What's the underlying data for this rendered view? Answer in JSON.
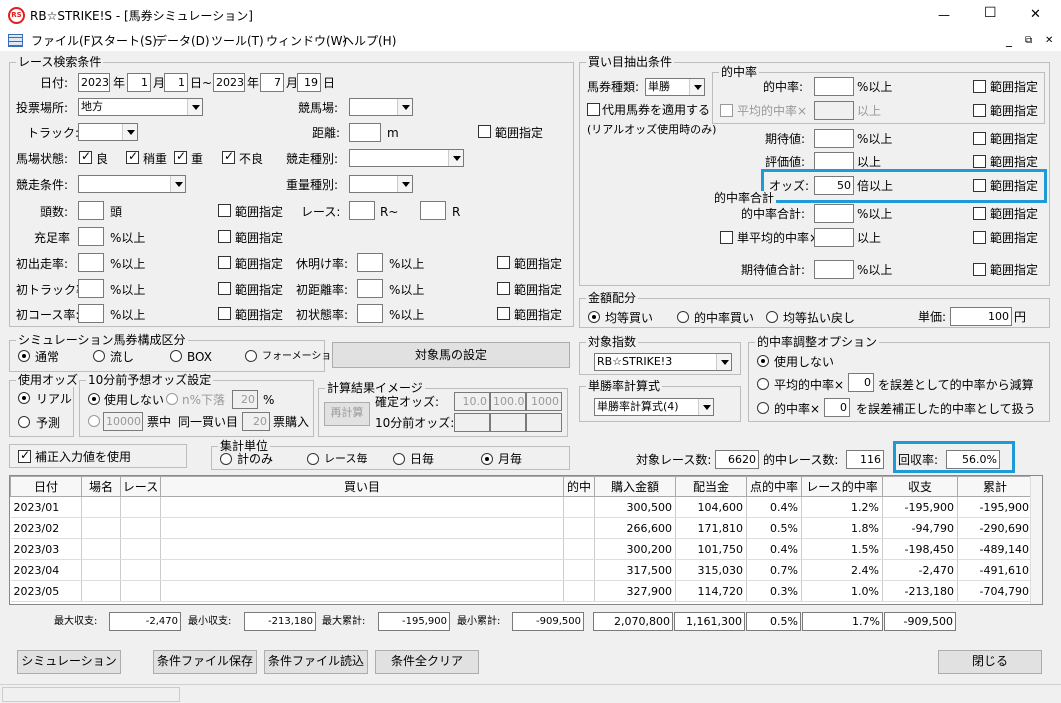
{
  "window": {
    "title": "RB☆STRIKE!S - [馬券シミュレーション]",
    "min": "—",
    "max": "☐",
    "close": "✕",
    "logo": "RS"
  },
  "menu": [
    "ファイル(F)",
    "スタート(S)",
    "データ(D)",
    "ツール(T)",
    "ウィンドウ(W)",
    "ヘルプ(H)"
  ],
  "race": {
    "group": "レース検索条件",
    "date_label": "日付:",
    "from_y": "2023",
    "nen1": "年",
    "from_m": "1",
    "tsuki1": "月",
    "from_d": "1",
    "nichi_tilde": "日~",
    "to_y": "2023",
    "nen2": "年",
    "to_m": "7",
    "tsuki2": "月",
    "to_d": "19",
    "nichi2": "日",
    "venue_label": "投票場所:",
    "venue": "地方",
    "course_label": "競馬場:",
    "track_label": "トラック:",
    "dist_label": "距離:",
    "dist_unit": "m",
    "range": "範囲指定",
    "cond_label": "馬場状態:",
    "cond_ryo": "良",
    "cond_yayaomo": "稍重",
    "cond_omo": "重",
    "cond_furyo": "不良",
    "type_label": "競走種別:",
    "jouken_label": "競走条件:",
    "weight_label": "重量種別:",
    "heads_label": "頭数:",
    "heads_unit": "頭",
    "race_label": "レース:",
    "race_mid": "R~",
    "race_end": "R",
    "jusoku_label": "充足率",
    "pct_ijo": "%以上",
    "first_run": "初出走率:",
    "rest": "休明け率:",
    "first_track": "初トラック率:",
    "first_dist": "初距離率:",
    "first_course": "初コース率:",
    "first_cond": "初状態率:"
  },
  "sim": {
    "group": "シミュレーション馬券構成区分",
    "opts": [
      "通常",
      "流し",
      "BOX",
      "フォーメーション"
    ],
    "target_btn": "対象馬の設定"
  },
  "odds_use": {
    "group": "使用オッズ",
    "opts": [
      "リアル",
      "予測"
    ]
  },
  "odds10": {
    "group": "10分前予想オッズ設定",
    "nouse": "使用しない",
    "n_drop": "n%下落",
    "n_val": "20",
    "pct": "%",
    "count": "10000",
    "chuu": "票中",
    "same": "同一買い目",
    "same_val": "20",
    "buy": "票購入"
  },
  "calc": {
    "group": "計算結果イメージ",
    "recalc": "再計算",
    "kakutei": "確定オッズ:",
    "k1": "10.0",
    "k2": "100.0",
    "k3": "1000",
    "before": "10分前オッズ:"
  },
  "hosei": "補正入力値を使用",
  "agg": {
    "group": "集計単位",
    "opts": [
      "計のみ",
      "レース毎",
      "日毎",
      "月毎"
    ]
  },
  "buy": {
    "group": "買い目抽出条件",
    "type_label": "馬券種類:",
    "type": "単勝",
    "daiyo": "代用馬券を適用する",
    "real_note": "(リアルオッズ使用時のみ)"
  },
  "hit": {
    "group": "的中率",
    "rate": "的中率:",
    "avg_rate": "平均的中率×",
    "ijo": "以上",
    "pct_ijo": "%以上",
    "exp": "期待値:",
    "eval": "評価値:",
    "odds": "オッズ:",
    "odds_val": "50",
    "bai_ijo": "倍以上",
    "range": "範囲指定"
  },
  "hitsum": {
    "group": "的中率合計",
    "sum": "的中率合計:",
    "tan_avg": "単平均的中率×",
    "exp_sum": "期待値合計:"
  },
  "money": {
    "group": "金額配分",
    "opts": [
      "均等買い",
      "的中率買い",
      "均等払い戻し"
    ],
    "unit_label": "単価:",
    "unit": "100",
    "yen": "円"
  },
  "index": {
    "group": "対象指数",
    "val": "RB☆STRIKE!3"
  },
  "tanformula": {
    "group": "単勝率計算式",
    "val": "単勝率計算式(4)"
  },
  "adjust": {
    "group": "的中率調整オプション",
    "nouse": "使用しない",
    "avg": "平均的中率×",
    "avg_v": "0",
    "avg_t": "を誤差として的中率から減算",
    "hit": "的中率×",
    "hit_v": "0",
    "hit_t": "を誤差補正した的中率として扱う"
  },
  "stats": {
    "target_label": "対象レース数:",
    "target": "6620",
    "hit_label": "的中レース数:",
    "hit": "116",
    "ret_label": "回収率:",
    "ret": "56.0%"
  },
  "table": {
    "headers": [
      "日付",
      "場名",
      "レース",
      "買い目",
      "的中",
      "購入金額",
      "配当金",
      "点的中率",
      "レース的中率",
      "収支",
      "累計"
    ],
    "rows": [
      [
        "2023/01",
        "",
        "",
        "",
        "",
        "300,500",
        "104,600",
        "0.4%",
        "1.2%",
        "-195,900",
        "-195,900"
      ],
      [
        "2023/02",
        "",
        "",
        "",
        "",
        "266,600",
        "171,810",
        "0.5%",
        "1.8%",
        "-94,790",
        "-290,690"
      ],
      [
        "2023/03",
        "",
        "",
        "",
        "",
        "300,200",
        "101,750",
        "0.4%",
        "1.5%",
        "-198,450",
        "-489,140"
      ],
      [
        "2023/04",
        "",
        "",
        "",
        "",
        "317,500",
        "315,030",
        "0.7%",
        "2.4%",
        "-2,470",
        "-491,610"
      ],
      [
        "2023/05",
        "",
        "",
        "",
        "",
        "327,900",
        "114,720",
        "0.3%",
        "1.0%",
        "-213,180",
        "-704,790"
      ]
    ]
  },
  "summary": {
    "max_label": "最大収支:",
    "max": "-2,470",
    "min_label": "最小収支:",
    "min": "-213,180",
    "maxsum_label": "最大累計:",
    "maxsum": "-195,900",
    "minsum_label": "最小累計:",
    "minsum": "-909,500",
    "buy": "2,070,800",
    "pay": "1,161,300",
    "pt": "0.5%",
    "race": "1.7%",
    "total": "-909,500"
  },
  "buttons": {
    "sim": "シミュレーション",
    "save": "条件ファイル保存",
    "load": "条件ファイル読込",
    "clear": "条件全クリア",
    "close": "閉じる"
  }
}
